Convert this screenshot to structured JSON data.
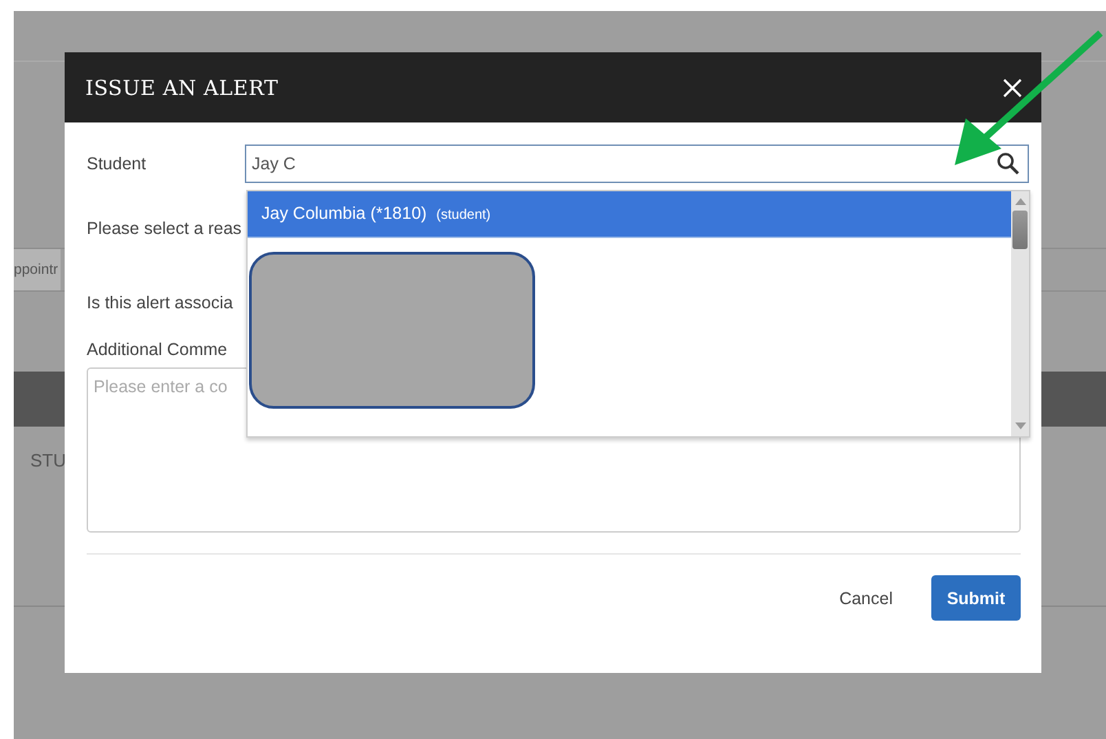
{
  "background": {
    "tab_label": "ppointr",
    "column_heading": "STU"
  },
  "dialog": {
    "title": "ISSUE AN ALERT",
    "student": {
      "label": "Student",
      "value": "Jay C"
    },
    "suggestions": [
      {
        "name": "Jay Columbia (*1810)",
        "role": "(student)",
        "selected": true
      }
    ],
    "fields": [
      {
        "kind": "label",
        "label": "Please select a reas"
      },
      {
        "kind": "label",
        "label": "Is this alert associa"
      },
      {
        "kind": "textarea",
        "label": "Additional Comme",
        "placeholder": "Please enter a co"
      }
    ],
    "buttons": {
      "cancel": "Cancel",
      "submit": "Submit"
    }
  }
}
